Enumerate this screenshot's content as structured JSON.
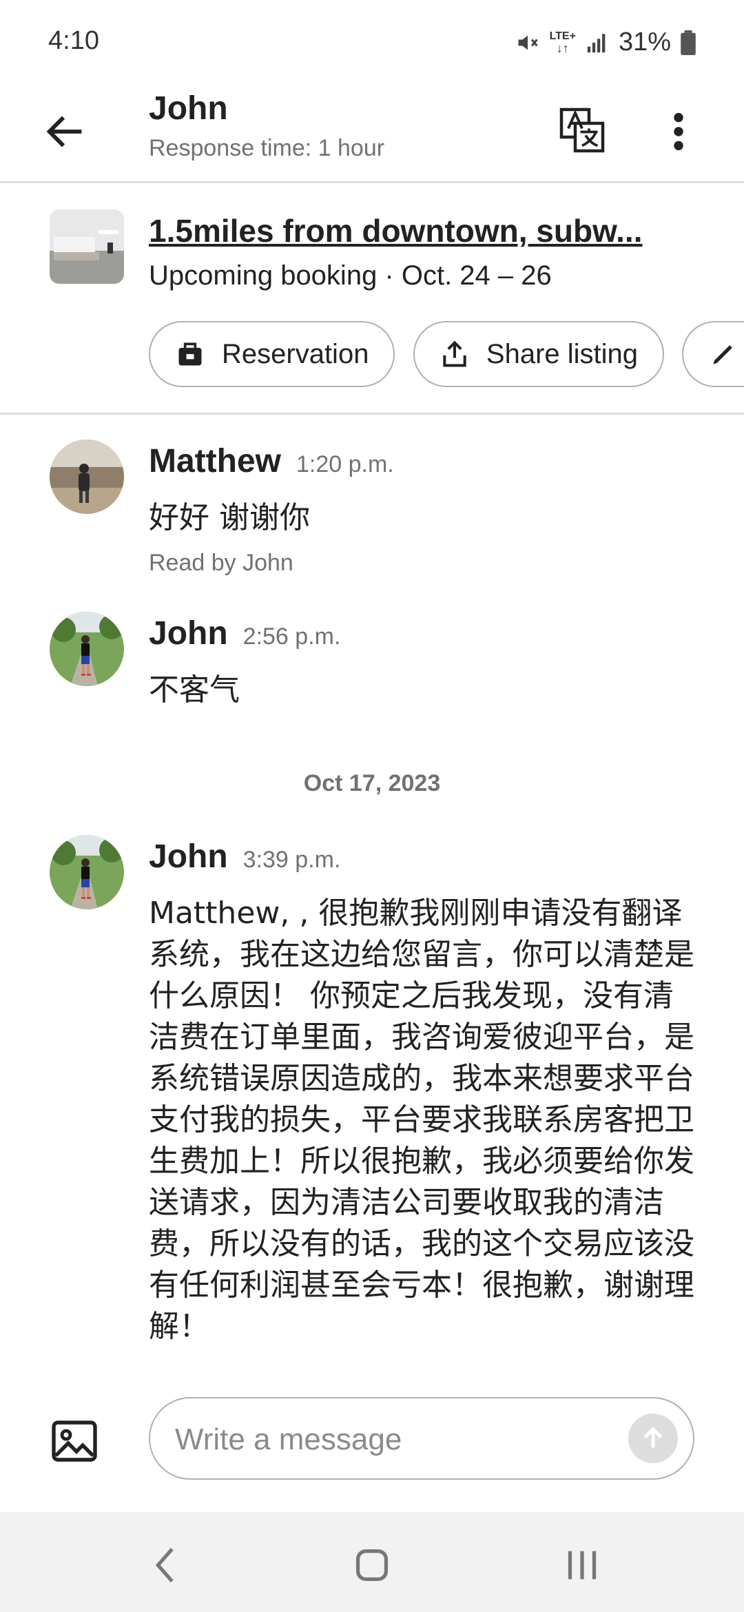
{
  "status_bar": {
    "time": "4:10",
    "network": "LTE+",
    "battery": "31%"
  },
  "header": {
    "title": "John",
    "subtitle": "Response time: 1 hour"
  },
  "listing": {
    "title": "1.5miles from downtown, subw...",
    "booking": "Upcoming booking · Oct. 24 – 26",
    "chips": [
      {
        "label": "Reservation",
        "icon": "briefcase-icon"
      },
      {
        "label": "Share listing",
        "icon": "share-icon"
      },
      {
        "label": "",
        "icon": "pencil-icon"
      }
    ]
  },
  "messages": [
    {
      "sender": "Matthew",
      "time": "1:20 p.m.",
      "text": "好好 谢谢你",
      "read_receipt": "Read by John"
    },
    {
      "sender": "John",
      "time": "2:56 p.m.",
      "text": "不客气"
    },
    {
      "sender": "John",
      "time": "3:39 p.m.",
      "text": "Matthew, , 很抱歉我刚刚申请没有翻译系统，我在这边给您留言，你可以清楚是什么原因！ 你预定之后我发现，没有清洁费在订单里面，我咨询爱彼迎平台，是系统错误原因造成的，我本来想要求平台支付我的损失，平台要求我联系房客把卫生费加上！所以很抱歉，我必须要给你发送请求，因为清洁公司要收取我的清洁费，所以没有的话，我的这个交易应该没有任何利润甚至会亏本！很抱歉，谢谢理解！"
    }
  ],
  "date_divider": "Oct 17, 2023",
  "composer": {
    "placeholder": "Write a message"
  },
  "colors": {
    "text_primary": "#222222",
    "text_secondary": "#717171",
    "divider": "#dddddd",
    "nav_background": "#f2f2f2"
  }
}
